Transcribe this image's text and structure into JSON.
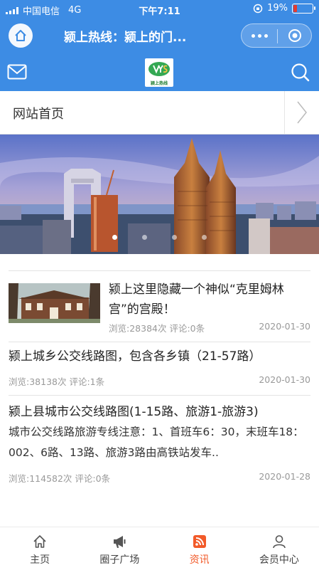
{
  "status_bar": {
    "carrier": "中国电信",
    "network": "4G",
    "time": "下午7:11",
    "battery": "19%",
    "battery_level": 0.19
  },
  "titlebar": {
    "title": "颍上热线：颍上的门..."
  },
  "site": {
    "logo_text": "颍上热线"
  },
  "nav": {
    "label": "网站首页"
  },
  "articles": [
    {
      "title": "颍上这里隐藏一个神似“克里姆林宫”的宫殿！",
      "views": "浏览:28384次",
      "comments": "评论:0条",
      "date": "2020-01-30"
    },
    {
      "title": "颍上城乡公交线路图，包含各乡镇（21-57路）",
      "views": "浏览:38138次",
      "comments": "评论:1条",
      "date": "2020-01-30"
    },
    {
      "title": "颍上县城市公交线路图(1-15路、旅游1-旅游3)",
      "desc": "城市公交线路旅游专线注意：1、首班车6：30，末班车18：002、6路、13路、旅游3路由高铁站发车..",
      "views": "浏览:114582次",
      "comments": "评论:0条",
      "date": "2020-01-28"
    }
  ],
  "tabs": [
    {
      "label": "主页",
      "icon": "home-icon"
    },
    {
      "label": "圈子广场",
      "icon": "megaphone-icon"
    },
    {
      "label": "资讯",
      "icon": "rss-icon"
    },
    {
      "label": "会员中心",
      "icon": "user-icon"
    }
  ],
  "colors": {
    "primary": "#3d8ce4",
    "accent": "#f25a29"
  }
}
